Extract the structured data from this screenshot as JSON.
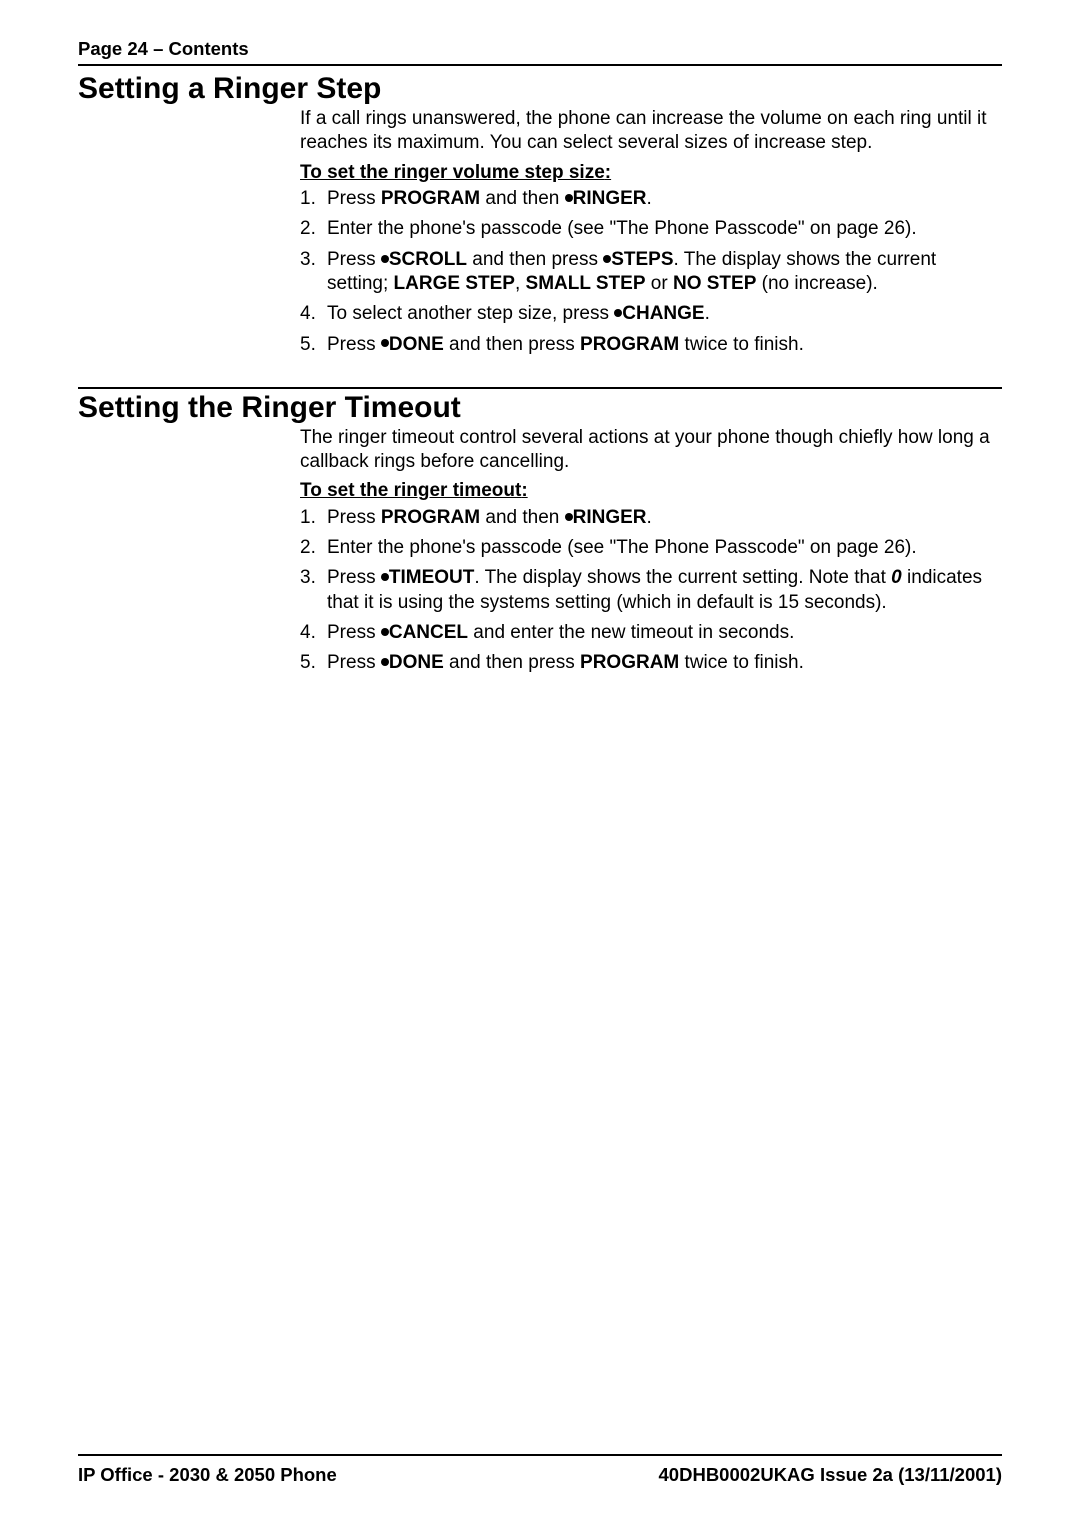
{
  "header": {
    "page_label": "Page 24 – Contents"
  },
  "section1": {
    "title": "Setting a Ringer Step",
    "intro": "If a call rings unanswered, the phone can increase the volume on each ring until it reaches its maximum. You can select several sizes of increase step.",
    "subhead": "To set the ringer volume step size",
    "step1_a": "Press ",
    "step1_b": "PROGRAM",
    "step1_c": " and then ",
    "step1_d": "RINGER",
    "step1_e": ".",
    "step2": "Enter the phone's passcode  (see \"The Phone Passcode\" on page 26).",
    "step3_a": "Press ",
    "step3_b": "SCROLL",
    "step3_c": " and then press ",
    "step3_d": "STEPS",
    "step3_e": ". The display shows the current setting; ",
    "step3_f": "LARGE STEP",
    "step3_g": ", ",
    "step3_h": "SMALL STEP",
    "step3_i": " or ",
    "step3_j": "NO STEP",
    "step3_k": " (no increase).",
    "step4_a": "To select another step size, press ",
    "step4_b": "CHANGE",
    "step4_c": ".",
    "step5_a": "Press ",
    "step5_b": "DONE",
    "step5_c": " and then press ",
    "step5_d": "PROGRAM",
    "step5_e": " twice to finish."
  },
  "section2": {
    "title": "Setting the Ringer Timeout",
    "intro": "The ringer timeout control several actions at your phone though chiefly how long a callback rings before cancelling.",
    "subhead": "To set the ringer timeout",
    "step1_a": "Press ",
    "step1_b": "PROGRAM",
    "step1_c": " and then ",
    "step1_d": "RINGER",
    "step1_e": ".",
    "step2": "Enter the phone's passcode  (see \"The Phone Passcode\" on page 26).",
    "step3_a": "Press ",
    "step3_b": "TIMEOUT",
    "step3_c": ". The display shows the current setting. Note that ",
    "step3_d": "0",
    "step3_e": " indicates that it is using the systems setting (which in default is 15 seconds).",
    "step4_a": "Press ",
    "step4_b": "CANCEL",
    "step4_c": " and enter the new timeout in seconds.",
    "step5_a": "Press ",
    "step5_b": "DONE",
    "step5_c": " and then press ",
    "step5_d": "PROGRAM",
    "step5_e": " twice to finish."
  },
  "footer": {
    "left": "IP Office - 2030 & 2050 Phone",
    "right": "40DHB0002UKAG Issue 2a (13/11/2001)"
  }
}
